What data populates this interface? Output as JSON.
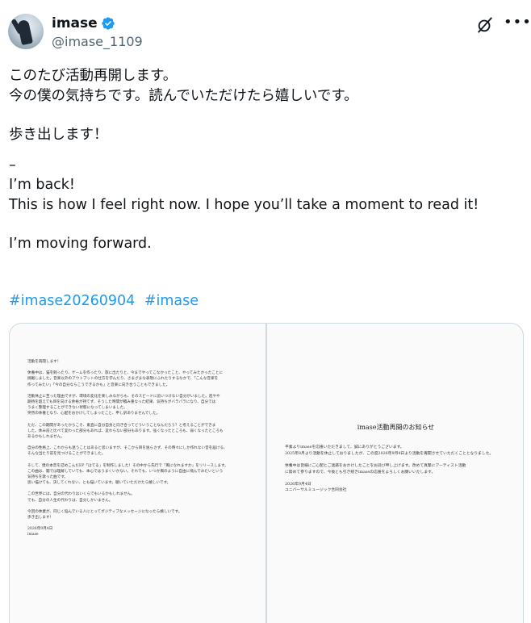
{
  "author": {
    "name": "imase",
    "handle": "@imase_1109",
    "verified": true
  },
  "actions": {
    "grok_icon": "grok-icon",
    "more_icon": "more-icon",
    "more_glyph": "•••"
  },
  "post": {
    "lines_ja": [
      "このたび活動再開します。",
      "今の僕の気持ちです。読んでいただけたら嬉しいです。"
    ],
    "line_ja_forward": "歩き出します！",
    "separator": "–",
    "lines_en": [
      "I’m back!",
      "This is how I feel right now. I hope you’ll take a moment to read it!"
    ],
    "line_en_forward": "I’m moving forward.",
    "hashtags": [
      "#imase20260904",
      "#imase"
    ]
  },
  "media": {
    "letter": {
      "lines": [
        "活動を再開します！",
        "",
        "休養中は、猫を飼ったり、ゲームを作ったり、旅に出たりと、今までやってこなかったこと、やってみたかったことに",
        "挑戦しました。音楽以外のアウトプットの仕方を学んだり、さまざまな表現にふれたりするなかで、「こんな音楽を",
        "作ってみたい」「今の自分ならこうできるかも」と音楽に向き合うこともできました。",
        "",
        "活動休止に至った理由ですが、環境の変化を楽しみながらも、そのスピードに追いつけない自分がいました。進やや",
        "期待を超えても目を向ける余裕が持てず、そうした時間が積み重なった結果、気持ちがバラバラになり、自分では",
        "うまく整理することができない状態になってしまいました。",
        "突然の休養となり、心配をおかけしてしまったこと、申し訳ありませんでした。",
        "",
        "ただ、この期間があったからこそ、素直に自分自身と向き合ってどういうことなんだろう？と考えることができま",
        "した。休み前と比べて変わった部分もあれば、変わらない部分もあります。強くなったところも、弱くなったところも",
        "あるかもしれません。",
        "",
        "自分の性格上、これからも迷うことはあると思いますが、そこから目を逸らさず、その時々にしか作れない音を届ける、",
        "そんな当たり前を見つけることができました。",
        "",
        "そして、僕の本音を詰めこんだEP「ほてる」を制作しました！その中から先行で「風になれますか」をリリースします。",
        "この曲は、聞では理解していても、本心ではうまくいかない。それでも、いつか風のように自由に飛んでみたいという",
        "気持ちを歌った曲です。",
        "思い描けても、決してくれない、とも描いています。聴いていただけたら嬉しいです。",
        "",
        "この世界には、自分の代わりはいくらでもいるかもしれません。",
        "でも、自分の人生の代わりは、自分しかいません。",
        "",
        "今回の休業が、同じく悩んでいる人にとってポジティブなメッセージになったら嬉しいです。",
        "歩き出します！",
        "",
        "2026年9月4日",
        "imase"
      ]
    },
    "notice": {
      "title": "imase活動再開のお知らせ",
      "lines": [
        "平素よりimaseを応援いただきまして、誠にありがとうございます。",
        "2025年8月より活動を休止しておりましたが、この度2026年9月4日より活動を再開させていただくこととなりました。",
        "",
        "休養中は皆様にご心配とご迷惑をおかけしたことをお詫び申し上げます。改めて真摯にアーティスト活動",
        "に努めて参りますので、今後とも引き続きimaseの応援をよろしくお願いいたします。",
        "",
        "2026年9月4日",
        "ユニバーサルミュージック合同会社"
      ]
    }
  },
  "colors": {
    "link": "#1d9bf0",
    "verified_badge": "#1d9bf0",
    "text": "#0f1419",
    "secondary": "#536471"
  }
}
